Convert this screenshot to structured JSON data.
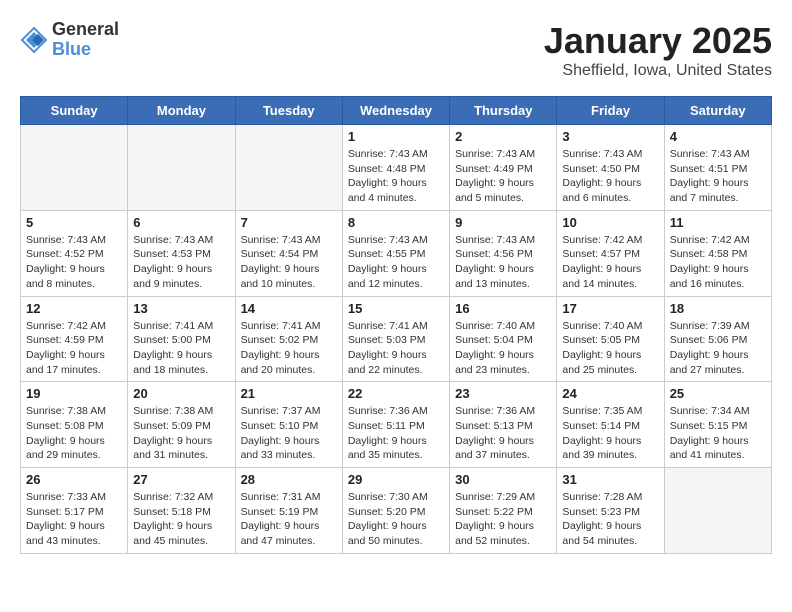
{
  "logo": {
    "general": "General",
    "blue": "Blue"
  },
  "title": "January 2025",
  "subtitle": "Sheffield, Iowa, United States",
  "days": [
    "Sunday",
    "Monday",
    "Tuesday",
    "Wednesday",
    "Thursday",
    "Friday",
    "Saturday"
  ],
  "weeks": [
    [
      {
        "num": "",
        "info": ""
      },
      {
        "num": "",
        "info": ""
      },
      {
        "num": "",
        "info": ""
      },
      {
        "num": "1",
        "info": "Sunrise: 7:43 AM\nSunset: 4:48 PM\nDaylight: 9 hours\nand 4 minutes."
      },
      {
        "num": "2",
        "info": "Sunrise: 7:43 AM\nSunset: 4:49 PM\nDaylight: 9 hours\nand 5 minutes."
      },
      {
        "num": "3",
        "info": "Sunrise: 7:43 AM\nSunset: 4:50 PM\nDaylight: 9 hours\nand 6 minutes."
      },
      {
        "num": "4",
        "info": "Sunrise: 7:43 AM\nSunset: 4:51 PM\nDaylight: 9 hours\nand 7 minutes."
      }
    ],
    [
      {
        "num": "5",
        "info": "Sunrise: 7:43 AM\nSunset: 4:52 PM\nDaylight: 9 hours\nand 8 minutes."
      },
      {
        "num": "6",
        "info": "Sunrise: 7:43 AM\nSunset: 4:53 PM\nDaylight: 9 hours\nand 9 minutes."
      },
      {
        "num": "7",
        "info": "Sunrise: 7:43 AM\nSunset: 4:54 PM\nDaylight: 9 hours\nand 10 minutes."
      },
      {
        "num": "8",
        "info": "Sunrise: 7:43 AM\nSunset: 4:55 PM\nDaylight: 9 hours\nand 12 minutes."
      },
      {
        "num": "9",
        "info": "Sunrise: 7:43 AM\nSunset: 4:56 PM\nDaylight: 9 hours\nand 13 minutes."
      },
      {
        "num": "10",
        "info": "Sunrise: 7:42 AM\nSunset: 4:57 PM\nDaylight: 9 hours\nand 14 minutes."
      },
      {
        "num": "11",
        "info": "Sunrise: 7:42 AM\nSunset: 4:58 PM\nDaylight: 9 hours\nand 16 minutes."
      }
    ],
    [
      {
        "num": "12",
        "info": "Sunrise: 7:42 AM\nSunset: 4:59 PM\nDaylight: 9 hours\nand 17 minutes."
      },
      {
        "num": "13",
        "info": "Sunrise: 7:41 AM\nSunset: 5:00 PM\nDaylight: 9 hours\nand 18 minutes."
      },
      {
        "num": "14",
        "info": "Sunrise: 7:41 AM\nSunset: 5:02 PM\nDaylight: 9 hours\nand 20 minutes."
      },
      {
        "num": "15",
        "info": "Sunrise: 7:41 AM\nSunset: 5:03 PM\nDaylight: 9 hours\nand 22 minutes."
      },
      {
        "num": "16",
        "info": "Sunrise: 7:40 AM\nSunset: 5:04 PM\nDaylight: 9 hours\nand 23 minutes."
      },
      {
        "num": "17",
        "info": "Sunrise: 7:40 AM\nSunset: 5:05 PM\nDaylight: 9 hours\nand 25 minutes."
      },
      {
        "num": "18",
        "info": "Sunrise: 7:39 AM\nSunset: 5:06 PM\nDaylight: 9 hours\nand 27 minutes."
      }
    ],
    [
      {
        "num": "19",
        "info": "Sunrise: 7:38 AM\nSunset: 5:08 PM\nDaylight: 9 hours\nand 29 minutes."
      },
      {
        "num": "20",
        "info": "Sunrise: 7:38 AM\nSunset: 5:09 PM\nDaylight: 9 hours\nand 31 minutes."
      },
      {
        "num": "21",
        "info": "Sunrise: 7:37 AM\nSunset: 5:10 PM\nDaylight: 9 hours\nand 33 minutes."
      },
      {
        "num": "22",
        "info": "Sunrise: 7:36 AM\nSunset: 5:11 PM\nDaylight: 9 hours\nand 35 minutes."
      },
      {
        "num": "23",
        "info": "Sunrise: 7:36 AM\nSunset: 5:13 PM\nDaylight: 9 hours\nand 37 minutes."
      },
      {
        "num": "24",
        "info": "Sunrise: 7:35 AM\nSunset: 5:14 PM\nDaylight: 9 hours\nand 39 minutes."
      },
      {
        "num": "25",
        "info": "Sunrise: 7:34 AM\nSunset: 5:15 PM\nDaylight: 9 hours\nand 41 minutes."
      }
    ],
    [
      {
        "num": "26",
        "info": "Sunrise: 7:33 AM\nSunset: 5:17 PM\nDaylight: 9 hours\nand 43 minutes."
      },
      {
        "num": "27",
        "info": "Sunrise: 7:32 AM\nSunset: 5:18 PM\nDaylight: 9 hours\nand 45 minutes."
      },
      {
        "num": "28",
        "info": "Sunrise: 7:31 AM\nSunset: 5:19 PM\nDaylight: 9 hours\nand 47 minutes."
      },
      {
        "num": "29",
        "info": "Sunrise: 7:30 AM\nSunset: 5:20 PM\nDaylight: 9 hours\nand 50 minutes."
      },
      {
        "num": "30",
        "info": "Sunrise: 7:29 AM\nSunset: 5:22 PM\nDaylight: 9 hours\nand 52 minutes."
      },
      {
        "num": "31",
        "info": "Sunrise: 7:28 AM\nSunset: 5:23 PM\nDaylight: 9 hours\nand 54 minutes."
      },
      {
        "num": "",
        "info": ""
      }
    ]
  ]
}
